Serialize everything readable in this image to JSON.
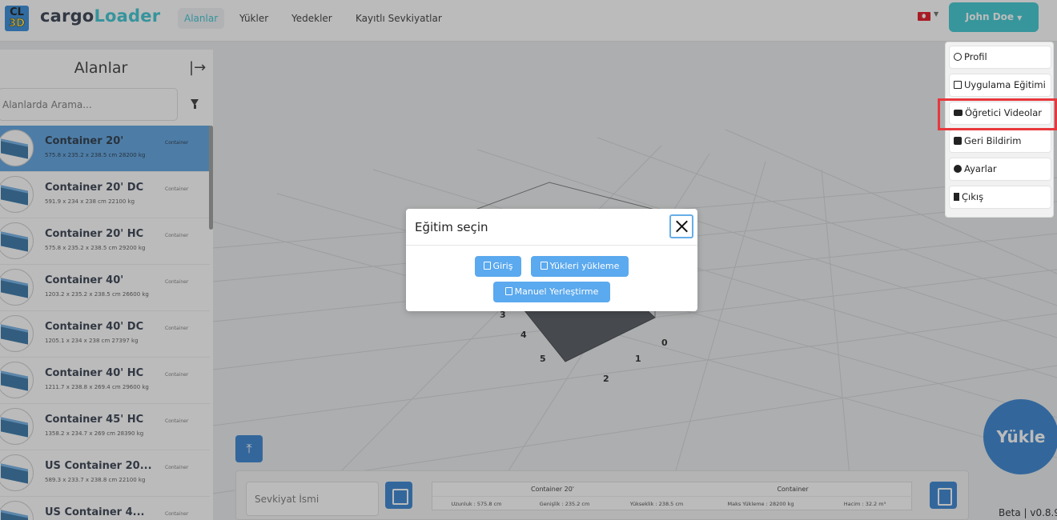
{
  "app": {
    "brand_part1": "cargo",
    "brand_part2": "Loader",
    "logo_line1": "CL",
    "logo_line2": "3D"
  },
  "nav": {
    "links": [
      {
        "label": "Alanlar",
        "active": true
      },
      {
        "label": "Yükler",
        "active": false
      },
      {
        "label": "Yedekler",
        "active": false
      },
      {
        "label": "Kayıtlı Sevkiyatlar",
        "active": false
      }
    ],
    "language_flag": "tr-flag-icon",
    "user_label": "John Doe"
  },
  "user_menu": {
    "items": [
      {
        "label": "Profil",
        "icon": "user-circle-icon"
      },
      {
        "label": "Uygulama Eğitimi",
        "icon": "book-icon"
      },
      {
        "label": "Öğretici Videolar",
        "icon": "youtube-icon"
      },
      {
        "label": "Geri Bildirim",
        "icon": "comment-icon"
      },
      {
        "label": "Ayarlar",
        "icon": "gear-icon"
      },
      {
        "label": "Çıkış",
        "icon": "door-icon"
      }
    ],
    "highlighted_item": "Öğretici Videolar"
  },
  "sidebar": {
    "title": "Alanlar",
    "search_placeholder": "Alanlarda Arama...",
    "items": [
      {
        "name": "Container 20'",
        "dims": "575.8 x 235.2 x 238.5 cm 28200 kg",
        "type": "Container",
        "selected": true
      },
      {
        "name": "Container 20' DC",
        "dims": "591.9 x 234 x 238 cm 22100 kg",
        "type": "Container",
        "selected": false
      },
      {
        "name": "Container 20' HC",
        "dims": "575.8 x 235.2 x 238.5 cm 29200 kg",
        "type": "Container",
        "selected": false
      },
      {
        "name": "Container 40'",
        "dims": "1203.2 x 235.2 x 238.5 cm 26600 kg",
        "type": "Container",
        "selected": false
      },
      {
        "name": "Container 40' DC",
        "dims": "1205.1 x 234 x 238 cm 27397 kg",
        "type": "Container",
        "selected": false
      },
      {
        "name": "Container 40' HC",
        "dims": "1211.7 x 238.8 x 269.4 cm 29600 kg",
        "type": "Container",
        "selected": false
      },
      {
        "name": "Container 45' HC",
        "dims": "1358.2 x 234.7 x 269 cm 28390 kg",
        "type": "Container",
        "selected": false
      },
      {
        "name": "US Container 20...",
        "dims": "589.3 x 233.7 x 238.8 cm 22100 kg",
        "type": "Container",
        "selected": false
      },
      {
        "name": "US Container 4...",
        "dims": "",
        "type": "Container",
        "selected": false
      }
    ]
  },
  "viewport": {
    "axis_labels": [
      "0",
      "1",
      "2",
      "3",
      "4",
      "5"
    ],
    "load_button": "Yükle"
  },
  "bottom_panel": {
    "shipment_name_placeholder": "Sevkiyat İsmi",
    "container_name": "Container 20'",
    "container_type": "Container",
    "specs": [
      "Uzunluk : 575.8 cm",
      "Genişlik : 235.2 cm",
      "Yükseklik : 238.5 cm",
      "Maks Yükleme : 28200 kg",
      "Hacim : 32.2 m³"
    ],
    "version": "Beta | v0.8.9"
  },
  "modal": {
    "title": "Eğitim seçin",
    "buttons": [
      "Giriş",
      "Yükleri yükleme",
      "Manuel Yerleştirme"
    ]
  }
}
